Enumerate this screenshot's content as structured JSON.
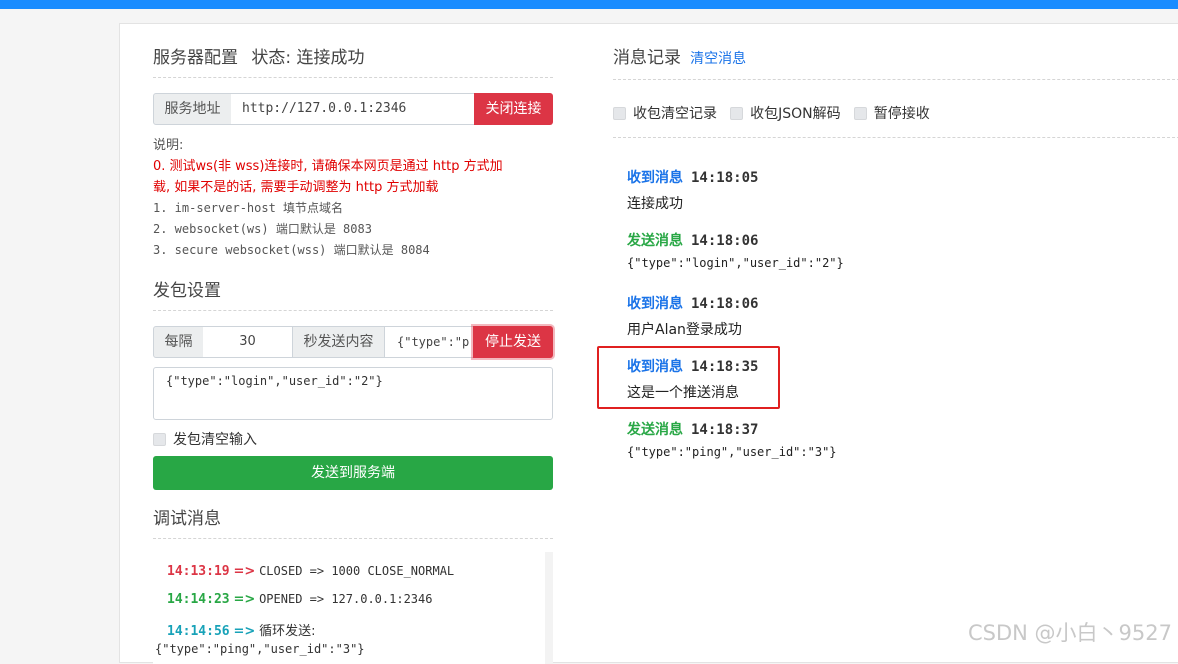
{
  "server_config": {
    "title": "服务器配置",
    "status": "状态: 连接成功",
    "addr_label": "服务地址",
    "addr_value": "http://127.0.0.1:2346",
    "close_button": "关闭连接"
  },
  "notes": {
    "heading": "说明:",
    "red_lines": [
      "0. 测试ws(非 wss)连接时, 请确保本网页是通过 http 方式加",
      "载, 如果不是的话, 需要手动调整为 http 方式加载"
    ],
    "lines": [
      "1. im-server-host 填节点域名",
      "2. websocket(ws) 端口默认是 8083",
      "3. secure websocket(wss) 端口默认是 8084"
    ]
  },
  "send_settings": {
    "title": "发包设置",
    "every_label": "每隔",
    "interval_value": "30",
    "content_label": "秒发送内容",
    "content_value": "{\"type\":\"p",
    "stop_button": "停止发送",
    "textarea_value": "{\"type\":\"login\",\"user_id\":\"2\"}",
    "clear_input_label": "发包清空输入",
    "send_button": "发送到服务端"
  },
  "debug": {
    "title": "调试消息",
    "lines": [
      {
        "time": "14:13:19",
        "arrow": "=>",
        "text": "CLOSED => 1000 CLOSE_NORMAL",
        "color": "#dc3545"
      },
      {
        "time": "14:14:23",
        "arrow": "=>",
        "text": "OPENED => 127.0.0.1:2346",
        "color": "#28a745"
      },
      {
        "time": "14:14:56",
        "arrow": "=>",
        "text": "循环发送:",
        "color": "#17a2b8"
      },
      {
        "time": "",
        "arrow": "",
        "text": "{\"type\":\"ping\",\"user_id\":\"3\"}",
        "color": "#333333"
      }
    ]
  },
  "messages": {
    "title": "消息记录",
    "clear_link": "清空消息",
    "options": [
      "收包清空记录",
      "收包JSON解码",
      "暂停接收"
    ],
    "items": [
      {
        "kind": "收到消息",
        "type": "recv",
        "time": "14:18:05",
        "body": "连接成功",
        "mono": false
      },
      {
        "kind": "发送消息",
        "type": "sent",
        "time": "14:18:06",
        "body": "{\"type\":\"login\",\"user_id\":\"2\"}",
        "mono": true
      },
      {
        "kind": "收到消息",
        "type": "recv",
        "time": "14:18:06",
        "body": "用户Alan登录成功",
        "mono": false
      },
      {
        "kind": "收到消息",
        "type": "recv",
        "time": "14:18:35",
        "body": "这是一个推送消息",
        "mono": false
      },
      {
        "kind": "发送消息",
        "type": "sent",
        "time": "14:18:37",
        "body": "{\"type\":\"ping\",\"user_id\":\"3\"}",
        "mono": true
      }
    ]
  },
  "watermark": "CSDN @小白丶9527"
}
